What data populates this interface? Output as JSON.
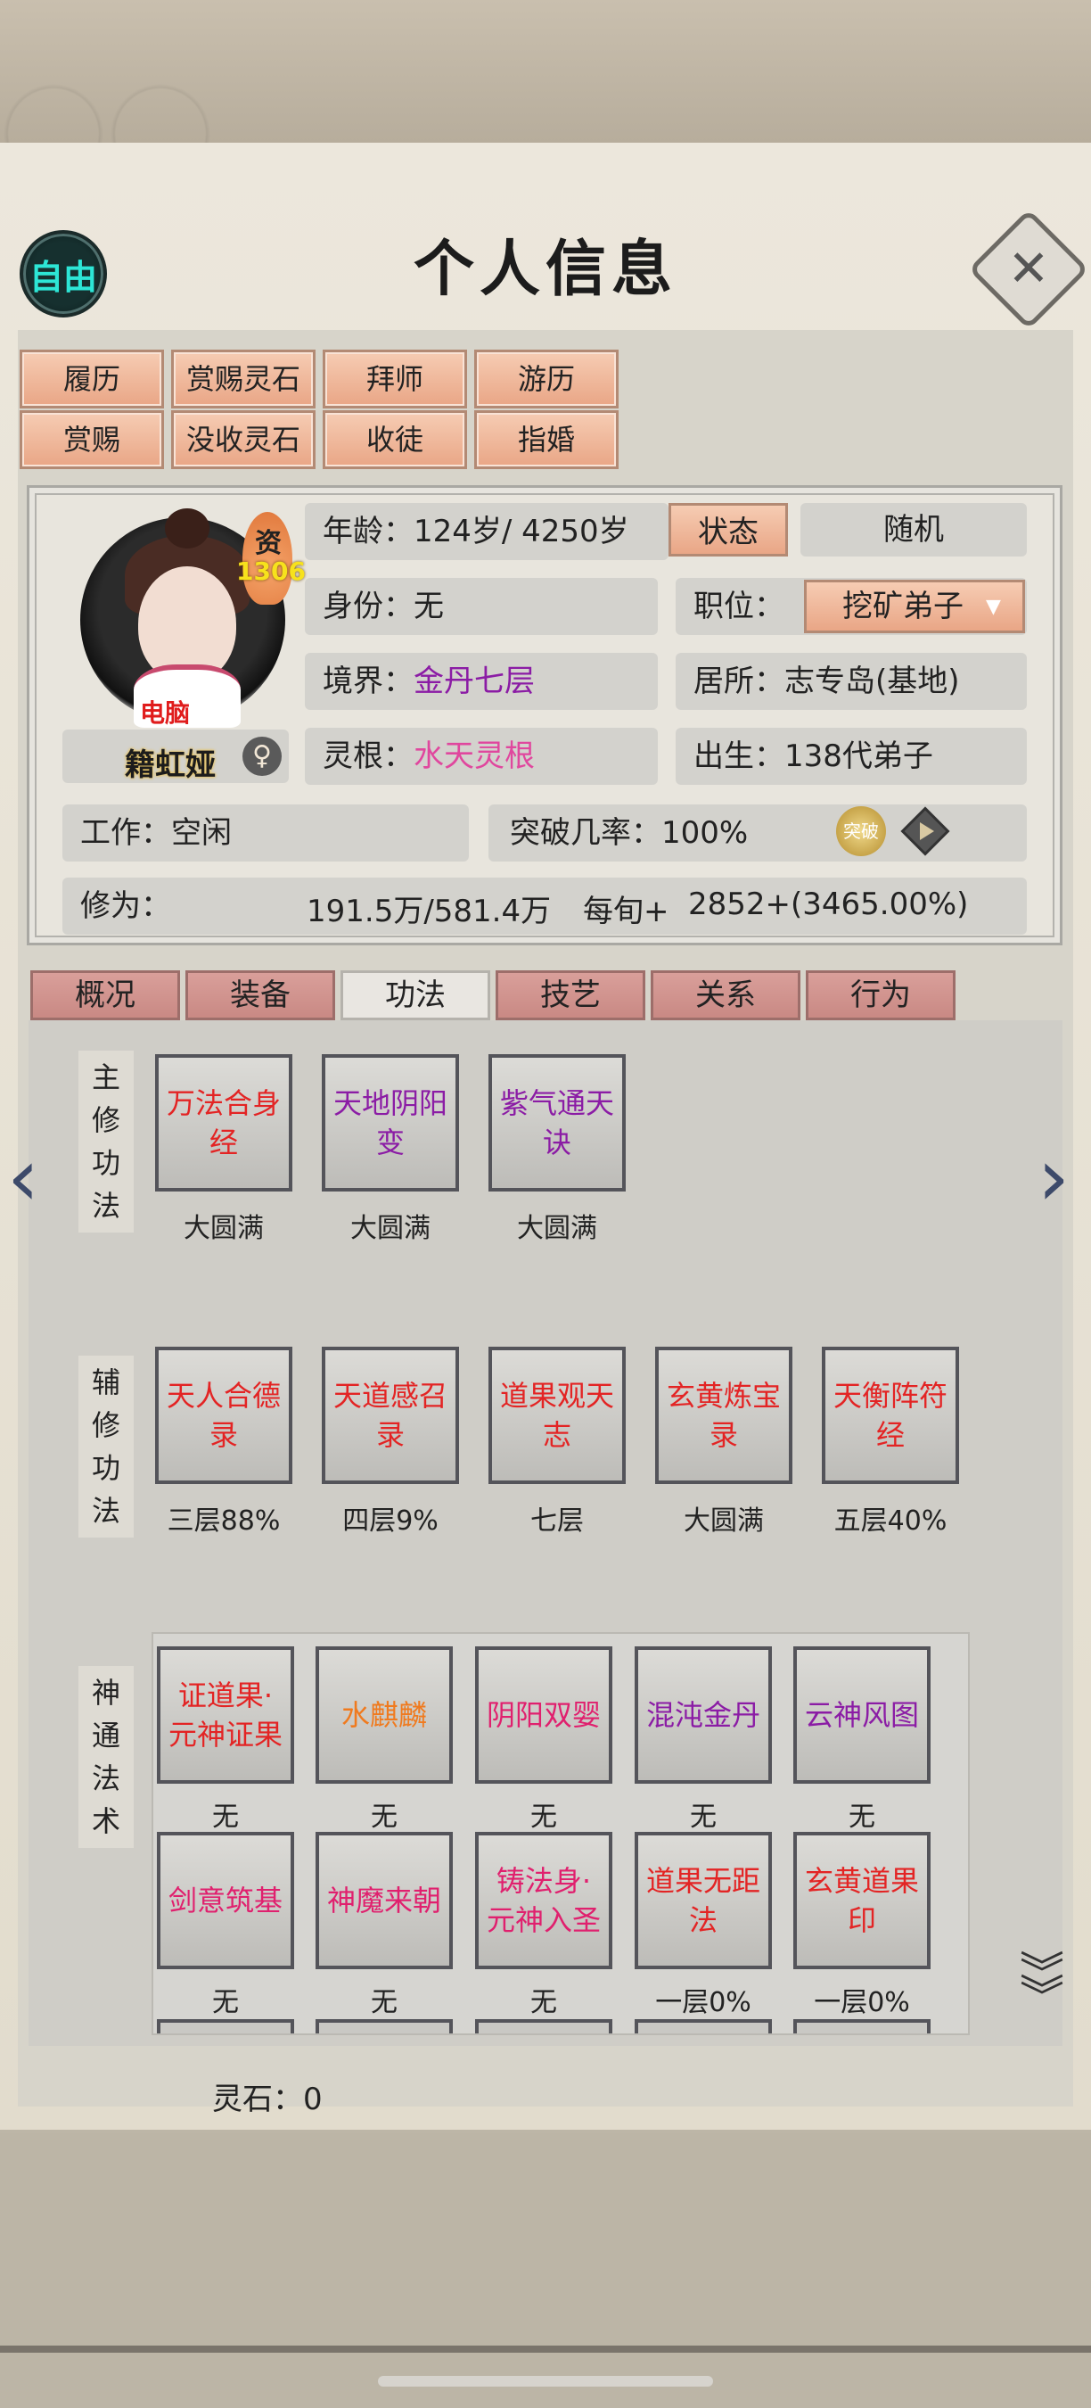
{
  "header": {
    "mode_badge": "自由",
    "title": "个人信息",
    "close_icon": "close-x-icon"
  },
  "actions": {
    "row1": [
      "履历",
      "赏赐灵石",
      "拜师",
      "游历"
    ],
    "row2": [
      "赏赐",
      "没收灵石",
      "收徒",
      "指婚"
    ]
  },
  "profile": {
    "aptitude_label": "资",
    "aptitude_value": "1306",
    "controller": "电脑",
    "name": "籍虹娅",
    "gender_icon": "female-icon",
    "age_label": "年龄：",
    "age_value": "124岁/ 4250岁",
    "status_button": "状态",
    "random_button": "随机",
    "identity_label": "身份：",
    "identity_value": "无",
    "position_label": "职位：",
    "position_value": "挖矿弟子",
    "realm_label": "境界：",
    "realm_value": "金丹七层",
    "residence_label": "居所：",
    "residence_value": "志专岛(基地)",
    "root_label": "灵根：",
    "root_value": "水天灵根",
    "birth_label": "出生：",
    "birth_value": "138代弟子",
    "work_label": "工作：",
    "work_value": "空闲",
    "breakthrough_label": "突破几率：",
    "breakthrough_value": "100%",
    "breakthrough_icon_text": "突破",
    "cultivation_label": "修为：",
    "cultivation_value": "191.5万/581.4万",
    "per_turn_label": "每旬+",
    "per_turn_value": "2852+(3465.00%)"
  },
  "tabs": [
    "概况",
    "装备",
    "功法",
    "技艺",
    "关系",
    "行为"
  ],
  "active_tab": "功法",
  "main_methods": {
    "label": "主修功法",
    "items": [
      {
        "name": "万法合身经",
        "level": "大圆满",
        "color": "red"
      },
      {
        "name": "天地阴阳变",
        "level": "大圆满",
        "color": "purple"
      },
      {
        "name": "紫气通天诀",
        "level": "大圆满",
        "color": "purple"
      }
    ]
  },
  "aux_methods": {
    "label": "辅修功法",
    "items": [
      {
        "name": "天人合德录",
        "level": "三层88%",
        "color": "red"
      },
      {
        "name": "天道感召录",
        "level": "四层9%",
        "color": "red"
      },
      {
        "name": "道果观天志",
        "level": "七层",
        "color": "red"
      },
      {
        "name": "玄黄炼宝录",
        "level": "大圆满",
        "color": "red"
      },
      {
        "name": "天衡阵符经",
        "level": "五层40%",
        "color": "red"
      }
    ]
  },
  "abilities": {
    "label": "神通法术",
    "items": [
      {
        "name": "证道果·元神证果",
        "level": "无",
        "color": "red"
      },
      {
        "name": "水麒麟",
        "level": "无",
        "color": "orange"
      },
      {
        "name": "阴阳双婴",
        "level": "无",
        "color": "magenta"
      },
      {
        "name": "混沌金丹",
        "level": "无",
        "color": "purple"
      },
      {
        "name": "云神风图",
        "level": "无",
        "color": "purple"
      },
      {
        "name": "剑意筑基",
        "level": "无",
        "color": "magenta"
      },
      {
        "name": "神魔来朝",
        "level": "无",
        "color": "magenta"
      },
      {
        "name": "铸法身·元神入圣",
        "level": "无",
        "color": "magenta"
      },
      {
        "name": "道果无距法",
        "level": "一层0%",
        "color": "red"
      },
      {
        "name": "玄黄道果印",
        "level": "一层0%",
        "color": "red"
      }
    ]
  },
  "footer": {
    "stones_label": "灵石：",
    "stones_value": "0"
  },
  "colors": {
    "red": "#e32424",
    "purple": "#8b1ca5",
    "magenta": "#e0206e",
    "orange": "#f07a1e",
    "button_peach": "#eeb497",
    "tab_rose": "#d19590"
  }
}
